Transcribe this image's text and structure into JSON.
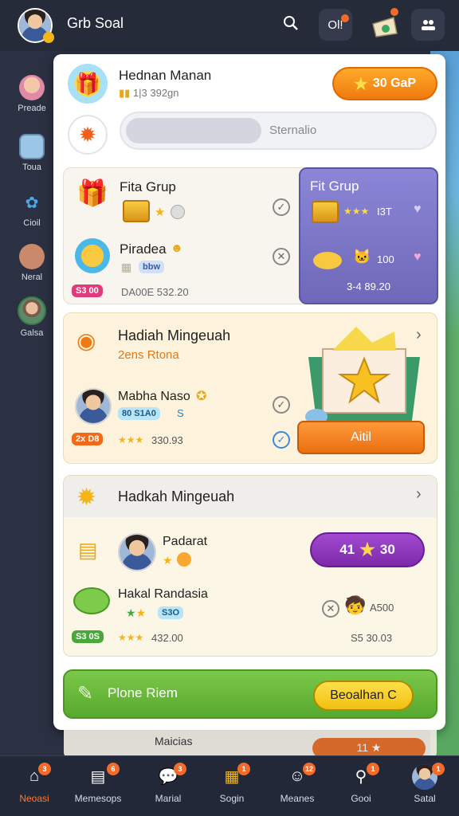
{
  "top": {
    "title": "Grb Soal",
    "coin_label": "Ol!",
    "search_icon": "search-icon",
    "menu_icon": "people-icon"
  },
  "rail": [
    {
      "label": "Preade",
      "icon": "avatar-icon"
    },
    {
      "label": "Toua",
      "icon": "board-icon"
    },
    {
      "label": "Cioil",
      "icon": "gear-icon"
    },
    {
      "label": "Neral",
      "icon": "cookie-icon"
    },
    {
      "label": "Galsa",
      "icon": "profile-icon"
    }
  ],
  "header": {
    "name": "Hednan Manan",
    "sub": "1|3 392gn",
    "gold_button": "30 GaP",
    "search_placeholder": "Sternalio"
  },
  "section1": {
    "row1_title": "Fita Grup",
    "row2_title": "Piradea",
    "row2_chip": "bbw",
    "footer_chip": "S3 00",
    "footer_text": "DA00E 532.20"
  },
  "purple_card": {
    "title": "Fit Grup",
    "row1_text": "I3T",
    "row2_text": "100",
    "footer": "3-4 89.20"
  },
  "section2": {
    "title": "Hadiah Mingeuah",
    "subtitle": "2ens Rtona",
    "row_name": "Mabha Naso",
    "row_chip": "80 S1A0",
    "row_chip_suffix": "S",
    "footer_chip": "2x D8",
    "footer_text": "330.93",
    "claim_label": "Aitil"
  },
  "section3": {
    "title": "Hadkah Mingeuah",
    "row1_name": "Padarat",
    "pill_left": "41",
    "pill_right": "30",
    "row2_name": "Hakal Randasia",
    "row2_chip": "S3O",
    "row2_side": "A500",
    "footer_chip": "S3 0S",
    "footer_text": "432.00",
    "footer_right": "S5 30.03"
  },
  "green_bar": {
    "label": "Plone Riem",
    "button": "Beoalhan C"
  },
  "under_card": {
    "text": "Maicias",
    "pill": "11"
  },
  "nav": [
    {
      "label": "Neoasi",
      "badge": "3",
      "active": true
    },
    {
      "label": "Memesops",
      "badge": "6"
    },
    {
      "label": "Marial",
      "badge": "3"
    },
    {
      "label": "Sogin",
      "badge": "1"
    },
    {
      "label": "Meanes",
      "badge": "12"
    },
    {
      "label": "Gooi",
      "badge": "1"
    },
    {
      "label": "Satal",
      "badge": "1"
    }
  ],
  "colors": {
    "accent_orange": "#f07a10",
    "accent_purple": "#7d2aaa",
    "accent_green": "#57a82e"
  }
}
